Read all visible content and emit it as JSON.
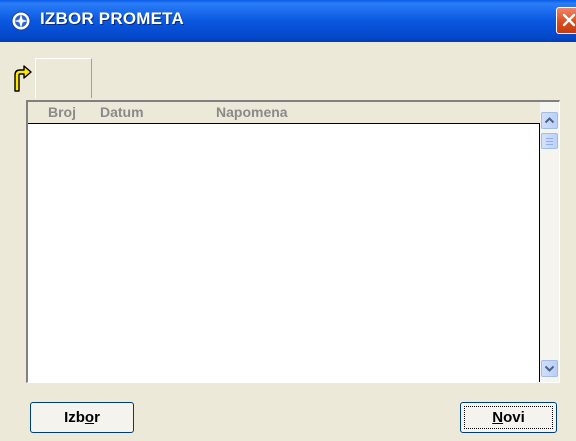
{
  "window": {
    "title": "IZBOR PROMETA",
    "icon": "compass-icon"
  },
  "grid": {
    "columns": [
      "Broj",
      "Datum",
      "Napomena"
    ],
    "rows": []
  },
  "buttons": {
    "izbor": {
      "pre": "Izb",
      "mnemonic": "o",
      "post": "r"
    },
    "novi": {
      "mnemonic": "N",
      "post": "ovi"
    }
  },
  "colors": {
    "titlebar": "#0a58e0",
    "close": "#d94a1c",
    "face": "#ece9d8"
  }
}
